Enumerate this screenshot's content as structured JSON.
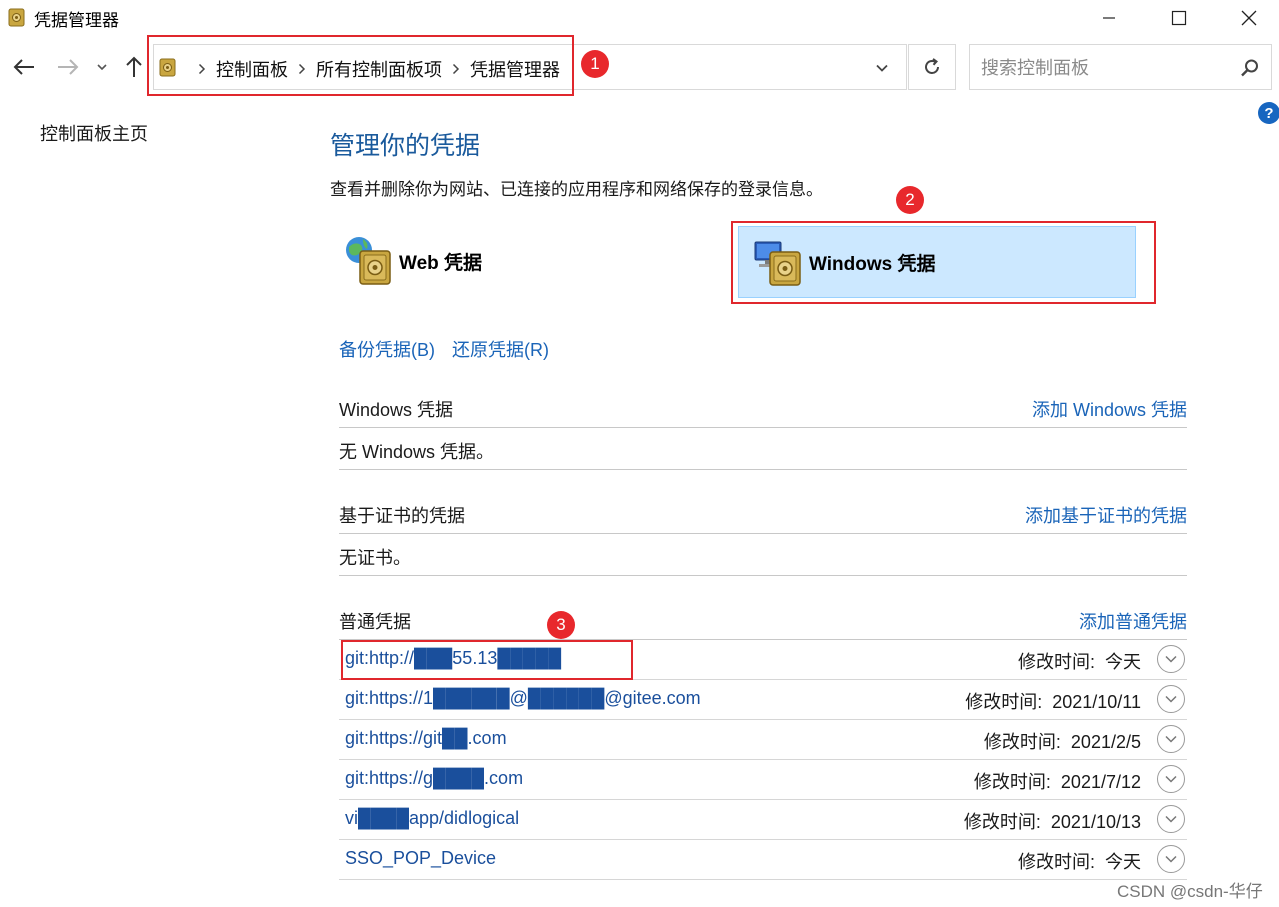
{
  "window": {
    "title": "凭据管理器",
    "minimize_icon": "minimize-icon",
    "maximize_icon": "maximize-icon",
    "close_icon": "close-icon"
  },
  "nav": {
    "breadcrumb": [
      "控制面板",
      "所有控制面板项",
      "凭据管理器"
    ],
    "refresh_icon": "refresh-icon"
  },
  "search": {
    "placeholder": "搜索控制面板"
  },
  "help": {
    "label": "?"
  },
  "left_pane": {
    "home_link": "控制面板主页"
  },
  "main": {
    "heading": "管理你的凭据",
    "subheading": "查看并删除你为网站、已连接的应用程序和网络保存的登录信息。",
    "credential_types": [
      {
        "label": "Web 凭据",
        "selected": false
      },
      {
        "label": "Windows 凭据",
        "selected": true
      }
    ],
    "backup_link": "备份凭据(B)",
    "restore_link": "还原凭据(R)",
    "sections": {
      "windows": {
        "title": "Windows 凭据",
        "add_link": "添加 Windows 凭据",
        "empty_text": "无 Windows 凭据。"
      },
      "certificate": {
        "title": "基于证书的凭据",
        "add_link": "添加基于证书的凭据",
        "empty_text": "无证书。"
      },
      "generic": {
        "title": "普通凭据",
        "add_link": "添加普通凭据",
        "modified_label": "修改时间:",
        "items": [
          {
            "name": "git:http://███55.13█████",
            "modified": "今天"
          },
          {
            "name": "git:https://1██████@██████@gitee.com",
            "modified": "2021/10/11"
          },
          {
            "name": "git:https://git██.com",
            "modified": "2021/2/5"
          },
          {
            "name": "git:https://g████.com",
            "modified": "2021/7/12"
          },
          {
            "name": "vi████app/didlogical",
            "modified": "2021/10/13"
          },
          {
            "name": "SSO_POP_Device",
            "modified": "今天"
          }
        ]
      }
    }
  },
  "annotations": {
    "badges": [
      "1",
      "2",
      "3"
    ],
    "color": "#e0272d"
  },
  "watermark": "CSDN @csdn-华仔",
  "colors": {
    "accent": "#1a64b8",
    "heading": "#1a5a9c",
    "selected_bg": "#cce8ff",
    "annotation": "#e0272d"
  }
}
